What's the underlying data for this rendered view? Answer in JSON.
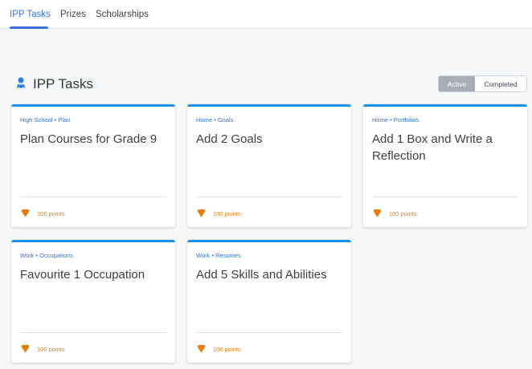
{
  "nav": {
    "tabs": [
      {
        "label": "IPP Tasks",
        "active": true
      },
      {
        "label": "Prizes",
        "active": false
      },
      {
        "label": "Scholarships",
        "active": false
      }
    ]
  },
  "section": {
    "title": "IPP Tasks",
    "icon": "person-award-icon"
  },
  "filter": {
    "active_label": "Active",
    "completed_label": "Completed",
    "selected": "Active"
  },
  "cards": [
    {
      "category": "High School • Plan",
      "title": "Plan Courses for Grade 9",
      "points": "100 points"
    },
    {
      "category": "Home • Goals",
      "title": "Add 2 Goals",
      "points": "100 points"
    },
    {
      "category": "Home • Portfolios",
      "title": "Add 1 Box and Write a Reflection",
      "points": "100 points"
    },
    {
      "category": "Work • Occupations",
      "title": "Favourite 1 Occupation",
      "points": "100 points"
    },
    {
      "category": "Work • Resumes",
      "title": "Add 5 Skills and Abilities",
      "points": "100 points"
    }
  ],
  "colors": {
    "accent": "#3b73e0",
    "card_border": "#1f8fe8",
    "points": "#e37d10",
    "toggle_active_bg": "#a9aeb6"
  }
}
